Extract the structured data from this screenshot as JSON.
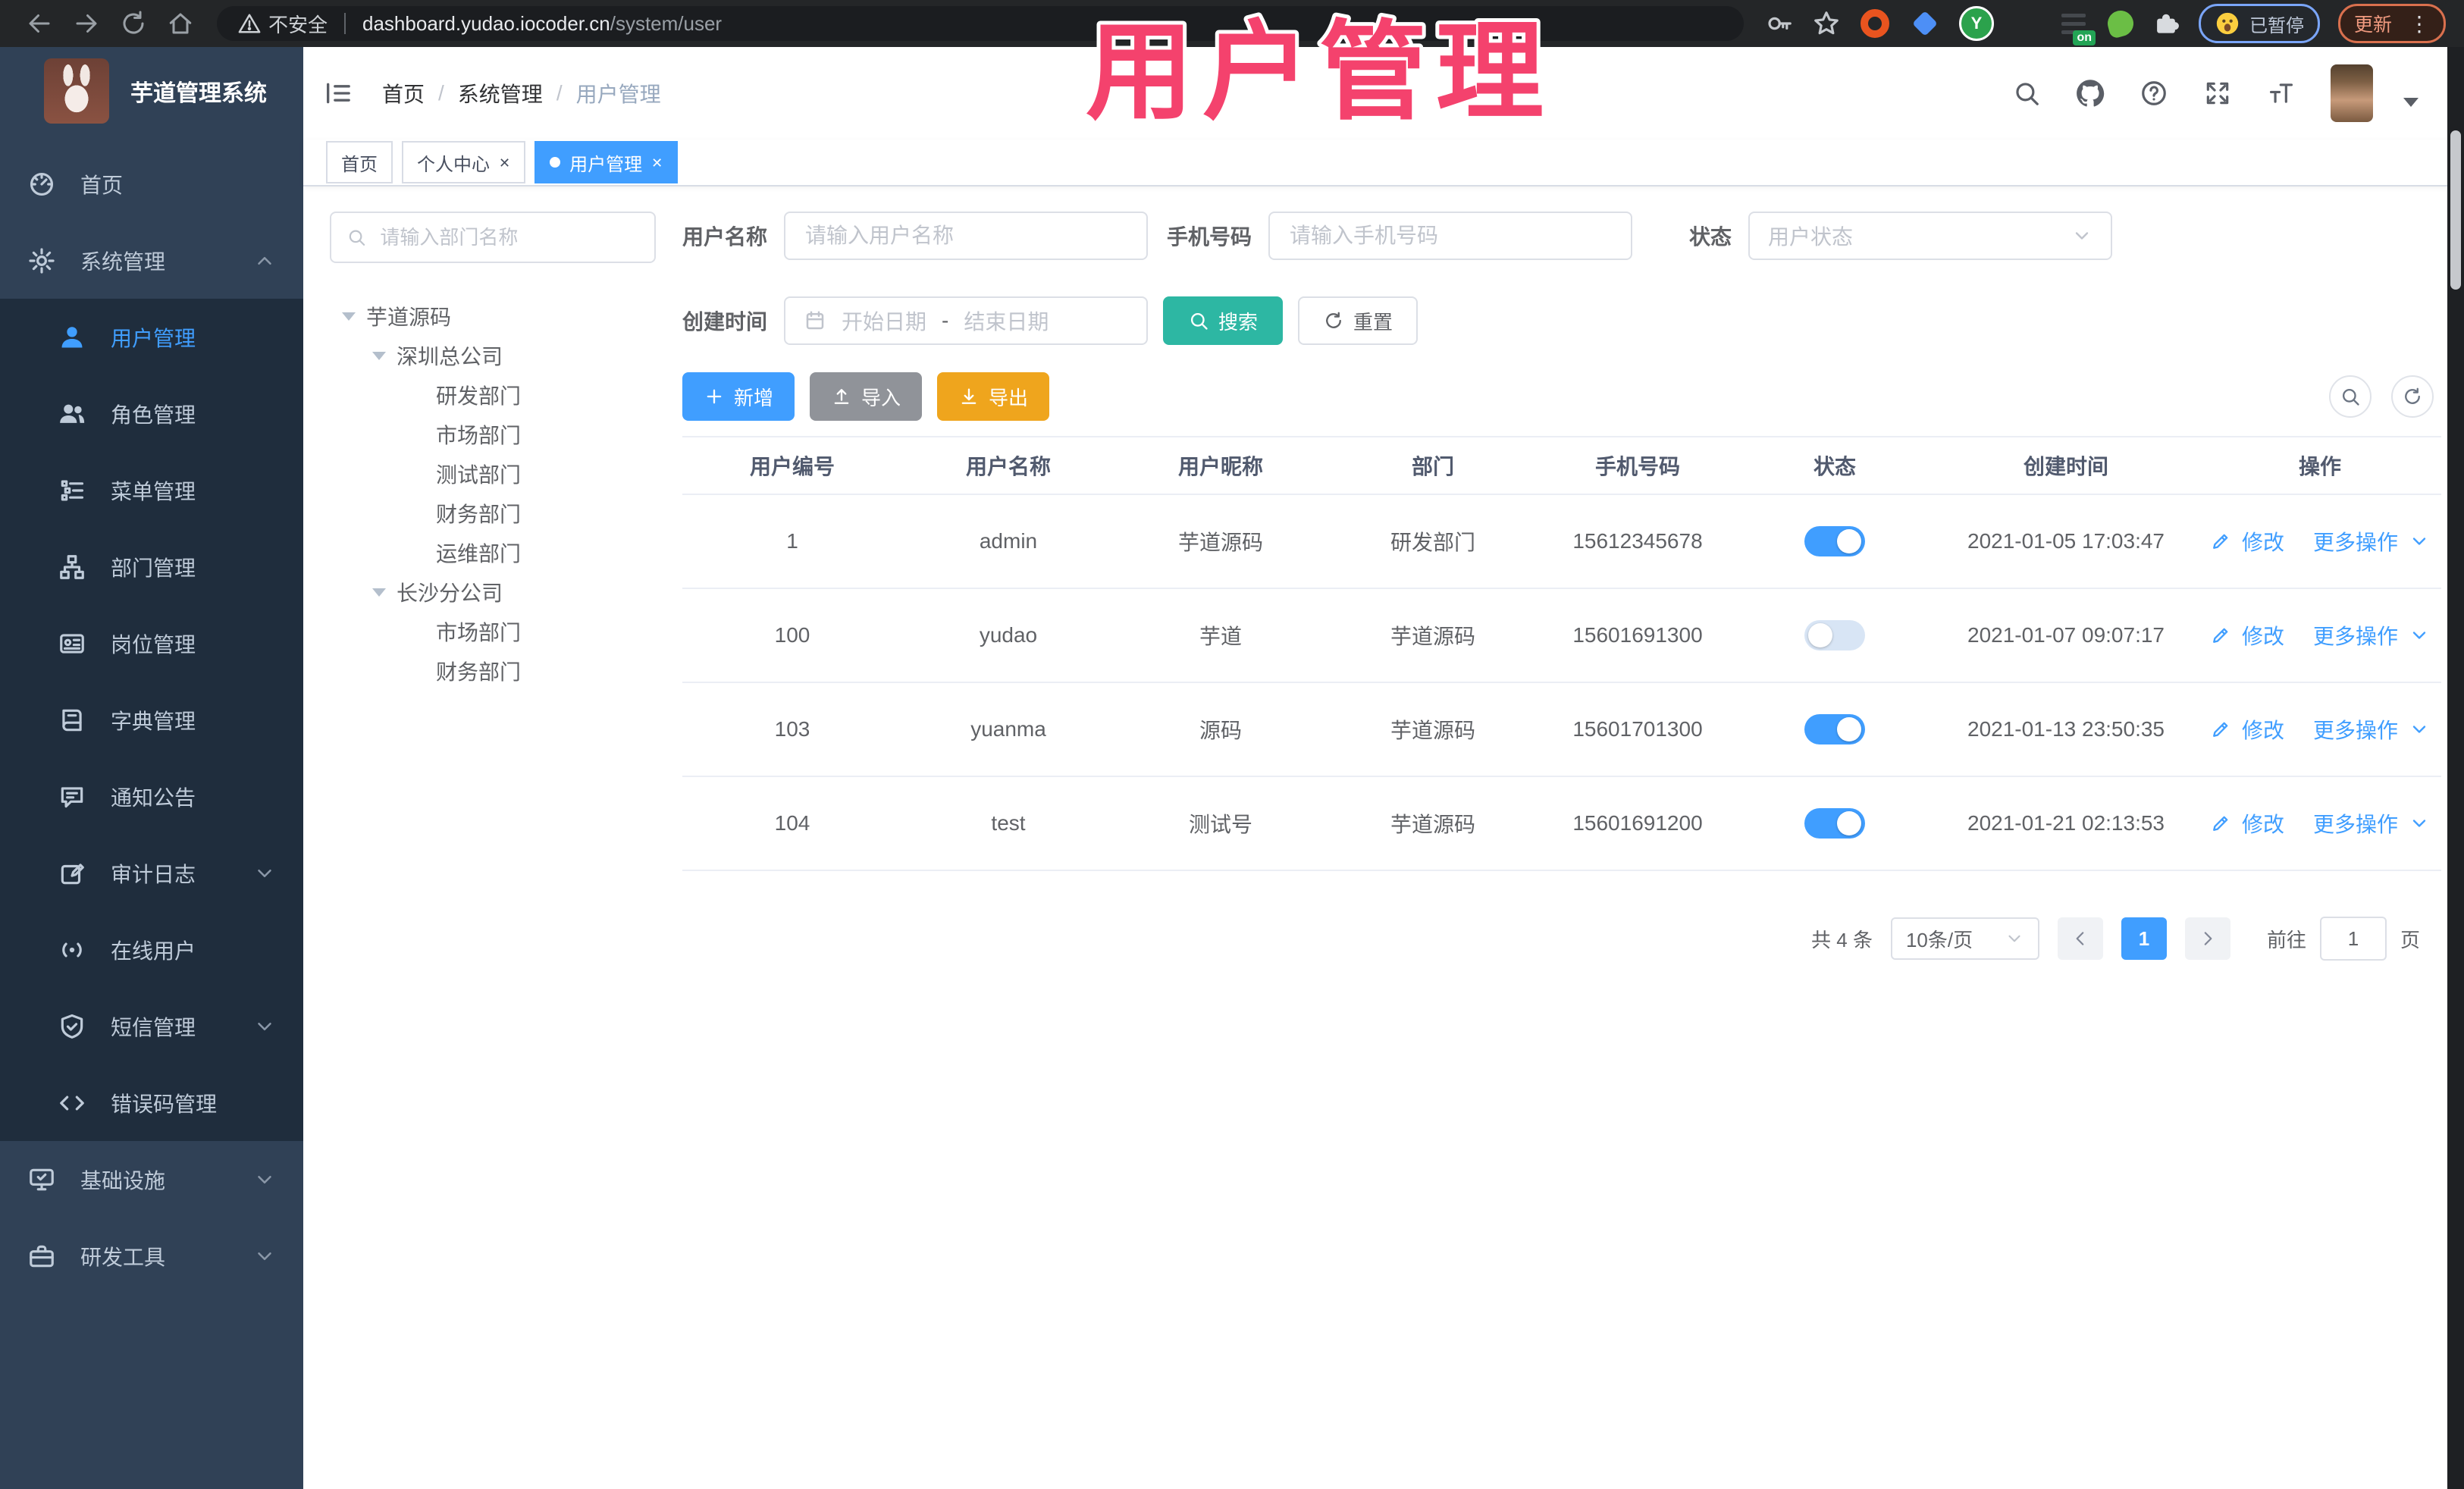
{
  "colors": {
    "accent_blue": "#409EFF",
    "search_teal": "#2DB7A3",
    "export_orange": "#EFA51D",
    "import_gray": "#909399",
    "overlay_pink": "#F4426D",
    "sidebar_bg": "#304156",
    "submenu_bg": "#1F2D3D"
  },
  "browser": {
    "security_label": "不安全",
    "url_host": "dashboard.yudao.iocoder.cn",
    "url_path": "/system/user",
    "paused_badge": "已暂停",
    "update_button": "更新",
    "extension_on_badge": "on"
  },
  "overlay": {
    "title": "用户管理"
  },
  "app": {
    "logo_title": "芋道管理系统",
    "breadcrumb": {
      "home": "首页",
      "section": "系统管理",
      "current": "用户管理",
      "sep": "/"
    },
    "tabs": {
      "t0": "首页",
      "t1": "个人中心",
      "t2": "用户管理"
    }
  },
  "sidebar": {
    "items": [
      {
        "label": "首页"
      },
      {
        "label": "系统管理"
      },
      {
        "label": "用户管理"
      },
      {
        "label": "角色管理"
      },
      {
        "label": "菜单管理"
      },
      {
        "label": "部门管理"
      },
      {
        "label": "岗位管理"
      },
      {
        "label": "字典管理"
      },
      {
        "label": "通知公告"
      },
      {
        "label": "审计日志"
      },
      {
        "label": "在线用户"
      },
      {
        "label": "短信管理"
      },
      {
        "label": "错误码管理"
      },
      {
        "label": "基础设施"
      },
      {
        "label": "研发工具"
      }
    ]
  },
  "dept_tree": {
    "search_placeholder": "请输入部门名称",
    "nodes": [
      {
        "label": "芋道源码"
      },
      {
        "label": "深圳总公司"
      },
      {
        "label": "研发部门"
      },
      {
        "label": "市场部门"
      },
      {
        "label": "测试部门"
      },
      {
        "label": "财务部门"
      },
      {
        "label": "运维部门"
      },
      {
        "label": "长沙分公司"
      },
      {
        "label": "市场部门"
      },
      {
        "label": "财务部门"
      }
    ]
  },
  "filters": {
    "username_label": "用户名称",
    "username_placeholder": "请输入用户名称",
    "mobile_label": "手机号码",
    "mobile_placeholder": "请输入手机号码",
    "status_label": "状态",
    "status_placeholder": "用户状态",
    "date_label": "创建时间",
    "date_start": "开始日期",
    "date_sep": "-",
    "date_end": "结束日期",
    "search": "搜索",
    "reset": "重置"
  },
  "toolbar": {
    "add": "新增",
    "import": "导入",
    "export": "导出"
  },
  "table": {
    "columns": [
      "用户编号",
      "用户名称",
      "用户昵称",
      "部门",
      "手机号码",
      "状态",
      "创建时间",
      "操作"
    ],
    "ops_edit": "修改",
    "ops_more": "更多操作",
    "rows": [
      {
        "id": "1",
        "username": "admin",
        "nickname": "芋道源码",
        "dept": "研发部门",
        "mobile": "15612345678",
        "status": true,
        "created": "2021-01-05 17:03:47"
      },
      {
        "id": "100",
        "username": "yudao",
        "nickname": "芋道",
        "dept": "芋道源码",
        "mobile": "15601691300",
        "status": false,
        "created": "2021-01-07 09:07:17"
      },
      {
        "id": "103",
        "username": "yuanma",
        "nickname": "源码",
        "dept": "芋道源码",
        "mobile": "15601701300",
        "status": true,
        "created": "2021-01-13 23:50:35"
      },
      {
        "id": "104",
        "username": "test",
        "nickname": "测试号",
        "dept": "芋道源码",
        "mobile": "15601691200",
        "status": true,
        "created": "2021-01-21 02:13:53"
      }
    ]
  },
  "pagination": {
    "total": "共 4 条",
    "size": "10条/页",
    "page": "1",
    "goto": "前往",
    "goto_value": "1",
    "unit": "页"
  }
}
